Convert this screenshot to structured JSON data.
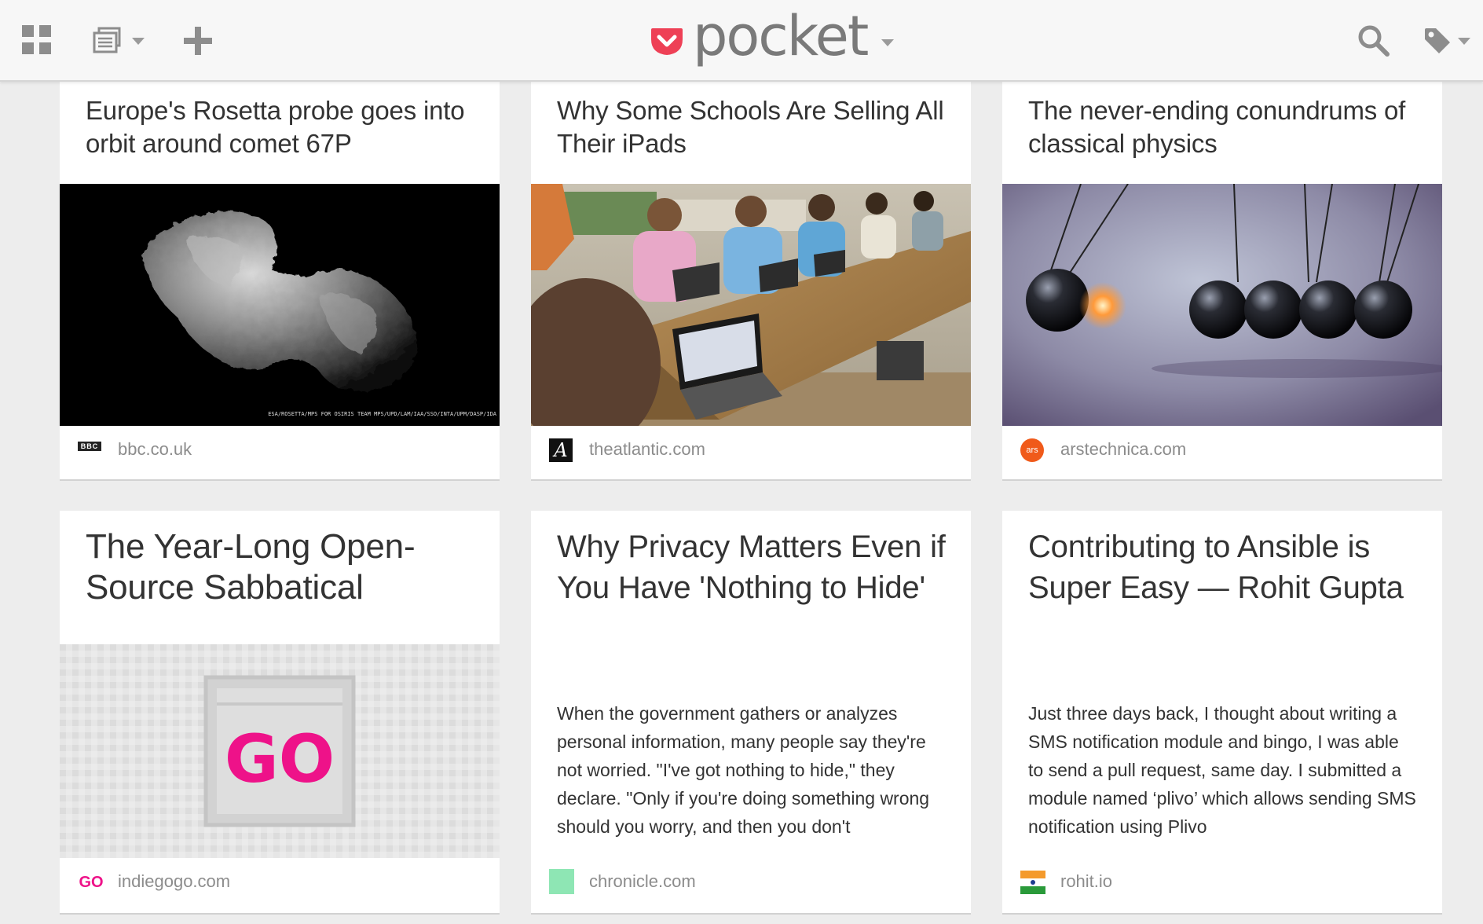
{
  "app": {
    "logo_text": "pocket",
    "colors": {
      "brand": "#ee4056",
      "icon_gray": "#8d8d8d",
      "topbar_bg": "#f7f7f7",
      "page_bg": "#ededed"
    }
  },
  "toolbar": {
    "icons": [
      "grid-view-icon",
      "list-view-icon",
      "add-icon",
      "pocket-logo-icon",
      "search-icon",
      "tag-icon"
    ]
  },
  "cards": [
    {
      "title": "Europe's Rosetta probe goes into orbit around comet 67P",
      "image_credit": "ESA/ROSETTA/MPS FOR OSIRIS TEAM MPS/UPD/LAM/IAA/SSO/INTA/UPM/DASP/IDA",
      "source_label": "BBC",
      "domain": "bbc.co.uk"
    },
    {
      "title": "Why Some Schools Are Selling All Their iPads",
      "source_label": "A",
      "domain": "theatlantic.com"
    },
    {
      "title": "The never-ending conundrums of classical physics",
      "source_label": "ars",
      "domain": "arstechnica.com"
    },
    {
      "title": "The Year-Long Open-Source Sabbatical",
      "image_text": "GO",
      "source_label": "GO",
      "domain": "indiegogo.com"
    },
    {
      "title": "Why Privacy Matters Even if You Have 'Nothing to Hide'",
      "excerpt": "When the government gathers or analyzes personal information, many people say they're not worried. \"I've got nothing to hide,\" they declare. \"Only if you're doing something wrong should you worry, and then you don't",
      "domain": "chronicle.com"
    },
    {
      "title": "Contributing to Ansible is Super Easy — Rohit Gupta",
      "excerpt": "Just three days back, I thought about writing a SMS notification module and bingo, I was able to send a pull request, same day. I submitted a module named ‘plivo’ which allows sending SMS notification using Plivo",
      "domain": "rohit.io"
    }
  ]
}
